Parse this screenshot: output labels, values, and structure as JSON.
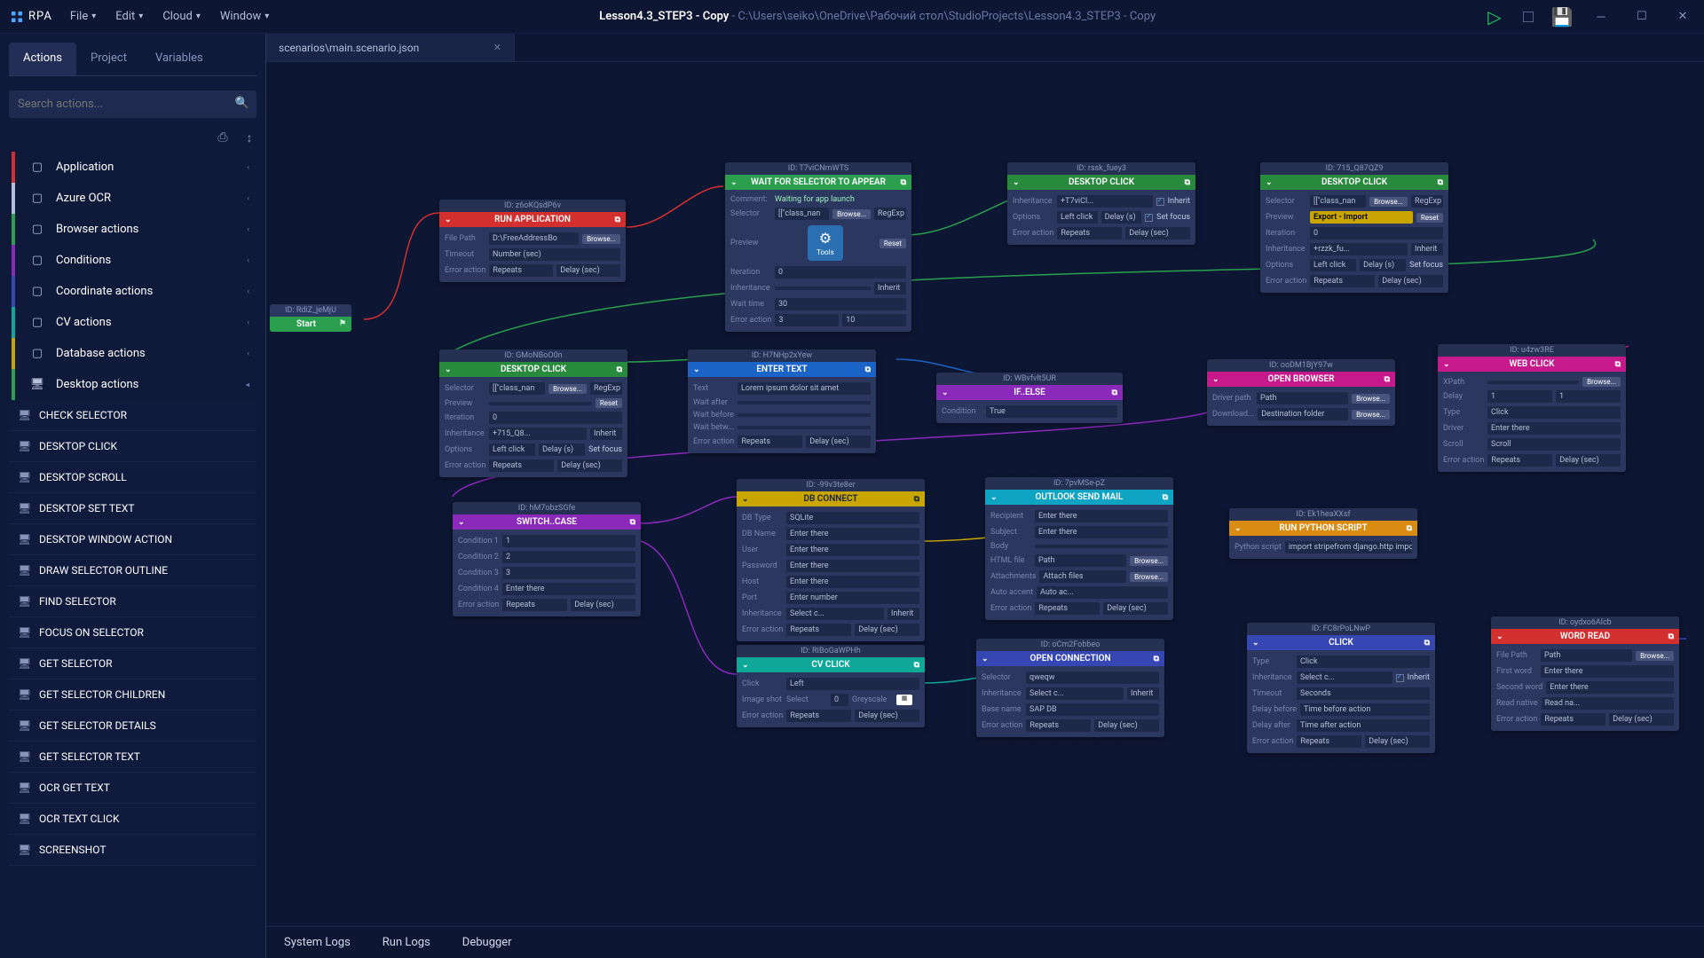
{
  "app": {
    "name": "RPA",
    "title_main": "Lesson4.3_STEP3 - Copy",
    "title_path": " - C:\\Users\\seiko\\OneDrive\\Рабочий стол\\StudioProjects\\Lesson4.3_STEP3 - Copy"
  },
  "menu": {
    "file": "File",
    "edit": "Edit",
    "cloud": "Cloud",
    "window": "Window"
  },
  "sidebar": {
    "tabs": {
      "actions": "Actions",
      "project": "Project",
      "variables": "Variables"
    },
    "search_placeholder": "Search actions...",
    "categories": [
      {
        "label": "Application",
        "color": "#d42f2f"
      },
      {
        "label": "Azure OCR",
        "color": "#b6bed8"
      },
      {
        "label": "Browser actions",
        "color": "#2aa04e"
      },
      {
        "label": "Conditions",
        "color": "#8a29ba"
      },
      {
        "label": "Coordinate actions",
        "color": "#3647b3"
      },
      {
        "label": "CV actions",
        "color": "#0fa898"
      },
      {
        "label": "Database actions",
        "color": "#c9a500"
      }
    ],
    "expanded": {
      "label": "Desktop actions",
      "items": [
        "CHECK SELECTOR",
        "DESKTOP CLICK",
        "DESKTOP SCROLL",
        "DESKTOP SET TEXT",
        "DESKTOP WINDOW ACTION",
        "DRAW SELECTOR OUTLINE",
        "FIND SELECTOR",
        "FOCUS ON SELECTOR",
        "GET SELECTOR",
        "GET SELECTOR CHILDREN",
        "GET SELECTOR DETAILS",
        "GET SELECTOR TEXT",
        "OCR GET TEXT",
        "OCR TEXT CLICK",
        "SCREENSHOT"
      ]
    }
  },
  "doc_tab": "scenarios\\main.scenario.json",
  "bottom": {
    "syslogs": "System Logs",
    "runlogs": "Run Logs",
    "debugger": "Debugger"
  },
  "nodes": {
    "start": {
      "id": "ID: RdiZ_jeMjU",
      "label": "Start"
    },
    "run_app": {
      "id": "ID: z6oKQsdP6v",
      "title": "RUN APPLICATION",
      "filepath_l": "File Path",
      "filepath": "D:\\FreeAddressBo",
      "browse": "Browse...",
      "timeout_l": "Timeout",
      "timeout": "Number (sec)",
      "err_l": "Error action",
      "err": "Repeats",
      "delay": "Delay (sec)"
    },
    "wait_sel": {
      "id": "ID: T7viCNmWTS",
      "title": "WAIT FOR SELECTOR TO APPEAR",
      "comment_l": "Comment:",
      "comment": "Waiting for app launch",
      "sel_l": "Selector",
      "sel": "[[\"class_nan",
      "browse": "Browse...",
      "mode": "RegExp",
      "preview_l": "Preview",
      "tool": "Tools",
      "reset": "Reset",
      "iter_l": "Iteration",
      "iter": "0",
      "inherit_l": "Inheritance",
      "inherit": "Inherit",
      "wait_l": "Wait time",
      "wait": "30",
      "err_l": "Error action",
      "err": "3",
      "errv": "10"
    },
    "dclick1": {
      "id": "ID: rssk_fuey3",
      "title": "DESKTOP CLICK",
      "inh_l": "Inheritance",
      "inh": "+T7viCl...",
      "chk": "Inherit",
      "opt_l": "Options",
      "opt": "Left click",
      "delay": "Delay (s)",
      "setfocus": "Set focus",
      "err_l": "Error action",
      "err": "Repeats",
      "delayv": "Delay (sec)"
    },
    "dclick2": {
      "id": "ID: 715_Q87QZ9",
      "title": "DESKTOP CLICK",
      "sel_l": "Selector",
      "sel": "[[\"class_nan",
      "browse": "Browse...",
      "mode": "RegExp",
      "preview_l": "Preview",
      "preview": "Export - Import",
      "reset": "Reset",
      "iter_l": "Iteration",
      "iter": "0",
      "inh_l": "Inheritance",
      "inh": "+rzzk_fu...",
      "chk": "Inherit",
      "opt_l": "Options",
      "opt": "Left click",
      "delay": "Delay (s)",
      "setfocus": "Set focus",
      "err_l": "Error action",
      "err": "Repeats",
      "delayv": "Delay (sec)"
    },
    "dclick3": {
      "id": "ID: GMoNBoO0n",
      "title": "DESKTOP CLICK",
      "sel_l": "Selector",
      "sel": "[[\"class_nan",
      "browse": "Browse...",
      "mode": "RegExp",
      "preview_l": "Preview",
      "preview": "",
      "reset": "Reset",
      "iter_l": "Iteration",
      "iter": "0",
      "inh_l": "Inheritance",
      "inh": "+715_Q8...",
      "chk": "Inherit",
      "opt_l": "Options",
      "opt": "Left click",
      "delay": "Delay (s)",
      "setfocus": "Set focus",
      "err_l": "Error action",
      "err": "Repeats",
      "delayv": "Delay (sec)"
    },
    "enter": {
      "id": "ID: H7NHp2xYew",
      "title": "ENTER TEXT",
      "text_l": "Text",
      "text": "Lorem ipsum dolor sit amet",
      "wa_l": "Wait after",
      "wb_l": "Wait before",
      "wbt_l": "Wait betw...",
      "err_l": "Error action",
      "err": "Repeats",
      "delayv": "Delay (sec)"
    },
    "ifelse": {
      "id": "ID: WBvfvlt5UR",
      "title": "IF..ELSE",
      "cond_l": "Condition",
      "cond": "True"
    },
    "openbrowser": {
      "id": "ID: ooDM1BjY97w",
      "title": "OPEN BROWSER",
      "drv_l": "Driver path",
      "drv": "Path",
      "browse": "Browse...",
      "dn_l": "Download...",
      "dn": "Destination folder"
    },
    "webclick": {
      "id": "ID: u4zw3RE",
      "title": "WEB CLICK",
      "xpath_l": "XPath",
      "browse": "Browse...",
      "delay_l": "Delay",
      "delay1": "1",
      "delay2": "1",
      "type_l": "Type",
      "type": "Click",
      "driver_l": "Driver",
      "driver": "Enter there",
      "scroll_l": "Scroll",
      "scroll": "Scroll",
      "err_l": "Error action",
      "err": "Repeats",
      "delayv": "Delay (sec)"
    },
    "switch": {
      "id": "ID: hM7obzSGfe",
      "title": "SWITCH..CASE",
      "c1l": "Condition 1",
      "c1": "1",
      "c2l": "Condition 2",
      "c2": "2",
      "c3l": "Condition 3",
      "c3": "3",
      "c4l": "Condition 4",
      "c4": "Enter there",
      "err_l": "Error action",
      "err": "Repeats",
      "delayv": "Delay (sec)"
    },
    "dbconn": {
      "id": "ID: -99v3te8er",
      "title": "DB CONNECT",
      "dt_l": "DB Type",
      "dt": "SQLite",
      "dn_l": "DB Name",
      "dn": "Enter there",
      "u_l": "User",
      "u": "Enter there",
      "p_l": "Password",
      "p": "Enter there",
      "h_l": "Host",
      "h": "Enter there",
      "port_l": "Port",
      "port": "Enter number",
      "inh_l": "Inheritance",
      "inh": "Select c...",
      "chk": "Inherit",
      "err_l": "Error action",
      "err": "Repeats",
      "delayv": "Delay (sec)"
    },
    "outlook": {
      "id": "ID: 7pvMSe-pZ",
      "title": "OUTLOOK SEND MAIL",
      "rec_l": "Recipient",
      "rec": "Enter there",
      "sub_l": "Subject",
      "sub": "Enter there",
      "body_l": "Body",
      "html_l": "HTML file",
      "html": "Path",
      "browse": "Browse...",
      "att_l": "Attachments",
      "att": "Attach files",
      "aacc_l": "Auto accent",
      "aacc": "Auto ac...",
      "err_l": "Error action",
      "err": "Repeats",
      "delayv": "Delay (sec)"
    },
    "python": {
      "id": "ID: Ek1heaXXsf",
      "title": "RUN PYTHON SCRIPT",
      "ps_l": "Python script",
      "ps": "import stripefrom django.http import t"
    },
    "cvclick": {
      "id": "ID: RIBoGaWPHh",
      "title": "CV CLICK",
      "click_l": "Click",
      "click": "Left",
      "sel_l": "Select",
      "sel": "0",
      "gs_l": "Greyscale",
      "img_l": "Image shot",
      "err_l": "Error action",
      "err": "Repeats",
      "delayv": "Delay (sec)"
    },
    "openconn": {
      "id": "ID: oCm2Fobbeo",
      "title": "OPEN CONNECTION",
      "sel_l": "Selector",
      "sel": "qweqw",
      "inh_l": "Inheritance",
      "inh": "Select c...",
      "chk": "Inherit",
      "bn_l": "Base name",
      "bn": "SAP DB",
      "err_l": "Error action",
      "err": "Repeats",
      "delayv": "Delay (sec)"
    },
    "click": {
      "id": "ID: FC8rPoLNwP",
      "title": "CLICK",
      "type_l": "Type",
      "type": "Click",
      "inh_l": "Inheritance",
      "inh": "Select c...",
      "chk": "Inherit",
      "tm_l": "Timeout",
      "tm": "Seconds",
      "db_l": "Delay before",
      "db": "Time before action",
      "da_l": "Delay after",
      "da": "Time after action",
      "err_l": "Error action",
      "err": "Repeats",
      "delayv": "Delay (sec)"
    },
    "wordread": {
      "id": "ID: oydxo6Alcb",
      "title": "WORD READ",
      "fp_l": "File Path",
      "fp": "Path",
      "browse": "Browse...",
      "fw_l": "First word",
      "fw": "Enter there",
      "sw_l": "Second word",
      "sw": "Enter there",
      "rn_l": "Read native",
      "rn": "Read na...",
      "err_l": "Error action",
      "err": "Repeats",
      "delayv": "Delay (sec)"
    }
  }
}
